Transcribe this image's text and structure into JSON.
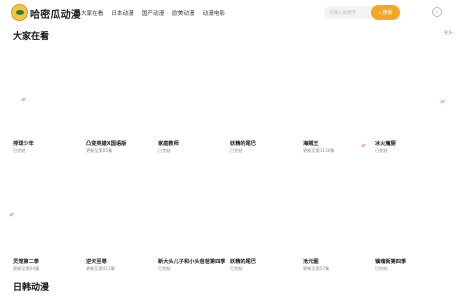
{
  "header": {
    "site_name": "哈密瓜动漫",
    "nav": [
      "大家在看",
      "日本动漫",
      "国产动漫",
      "欧美动漫",
      "动漫电影"
    ],
    "search_placeholder": "可输入关键字",
    "search_button": "搜索",
    "icons": {
      "logo": "melon-logo-icon",
      "search": "search-icon",
      "user": "user-icon"
    }
  },
  "sections": [
    {
      "title": "大家在看",
      "more": "更多"
    },
    {
      "title": "日韩动漫"
    }
  ],
  "cards_row1": [
    {
      "title": "排球少年",
      "sub": "已完结"
    },
    {
      "title": "凸变英雄X国语版",
      "sub": "更新至第05集"
    },
    {
      "title": "家庭教师",
      "sub": "已完结"
    },
    {
      "title": "妖精的尾巴",
      "sub": "已完结"
    },
    {
      "title": "海贼王",
      "sub": "更新至第1130集"
    },
    {
      "title": "冰火魔厨",
      "sub": "已完结"
    }
  ],
  "cards_row2": [
    {
      "title": "灵笼第二季",
      "sub": "更新至第04集"
    },
    {
      "title": "逆天至尊",
      "sub": "更新至第411集"
    },
    {
      "title": "新大头儿子和小头爸爸第四季",
      "sub": "已完结"
    },
    {
      "title": "妖精的尾巴",
      "sub": "已完结"
    },
    {
      "title": "沧元图",
      "sub": "更新至第57集"
    },
    {
      "title": "镇魂街第四季",
      "sub": "已完结"
    }
  ],
  "colors": {
    "accent": "#f5a623",
    "petal": "#f3b6c4"
  }
}
